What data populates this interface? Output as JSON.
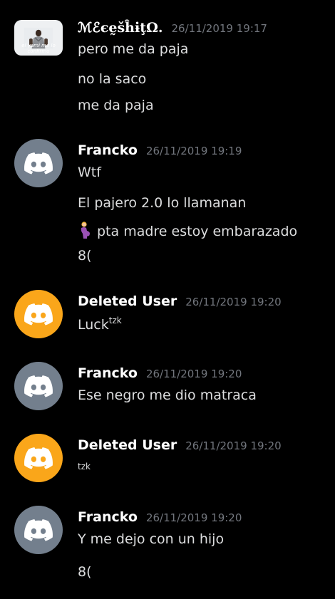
{
  "messages": [
    {
      "username": "ℳℰєḛšĥɨţΩ.",
      "timestamp": "26/11/2019 19:17",
      "avatar": {
        "type": "photo",
        "caption": "el yami me lo confirmo"
      },
      "lines": [
        "pero me da paja",
        "no la saco",
        "me da paja"
      ]
    },
    {
      "username": "Francko",
      "timestamp": "26/11/2019 19:19",
      "avatar": {
        "type": "discord-default",
        "color": "#737f8d",
        "icon": "discord-logo-icon"
      },
      "lines": [
        "Wtf",
        "El pajero 2.0  lo llamanan",
        "pta madre estoy embarazado",
        "8("
      ],
      "emoji": "pregnant-woman-icon"
    },
    {
      "username": "Deleted User",
      "timestamp": "26/11/2019 19:20",
      "avatar": {
        "type": "discord-default",
        "color": "#faa61a",
        "icon": "discord-logo-icon"
      },
      "lines": [
        "Luck",
        "tzk"
      ]
    },
    {
      "username": "Francko",
      "timestamp": "26/11/2019 19:20",
      "avatar": {
        "type": "discord-default",
        "color": "#737f8d",
        "icon": "discord-logo-icon"
      },
      "lines": [
        "Ese negro me dio matraca"
      ]
    },
    {
      "username": "Deleted User",
      "timestamp": "26/11/2019 19:20",
      "avatar": {
        "type": "discord-default",
        "color": "#faa61a",
        "icon": "discord-logo-icon"
      },
      "lines": [
        "tzk"
      ]
    },
    {
      "username": "Francko",
      "timestamp": "26/11/2019 19:20",
      "avatar": {
        "type": "discord-default",
        "color": "#737f8d",
        "icon": "discord-logo-icon"
      },
      "lines": [
        "Y me dejo con un hijo",
        "8("
      ]
    }
  ],
  "colors": {
    "background": "#000000",
    "username": "#ffffff",
    "timestamp": "#72767d",
    "text": "#dcddde"
  }
}
